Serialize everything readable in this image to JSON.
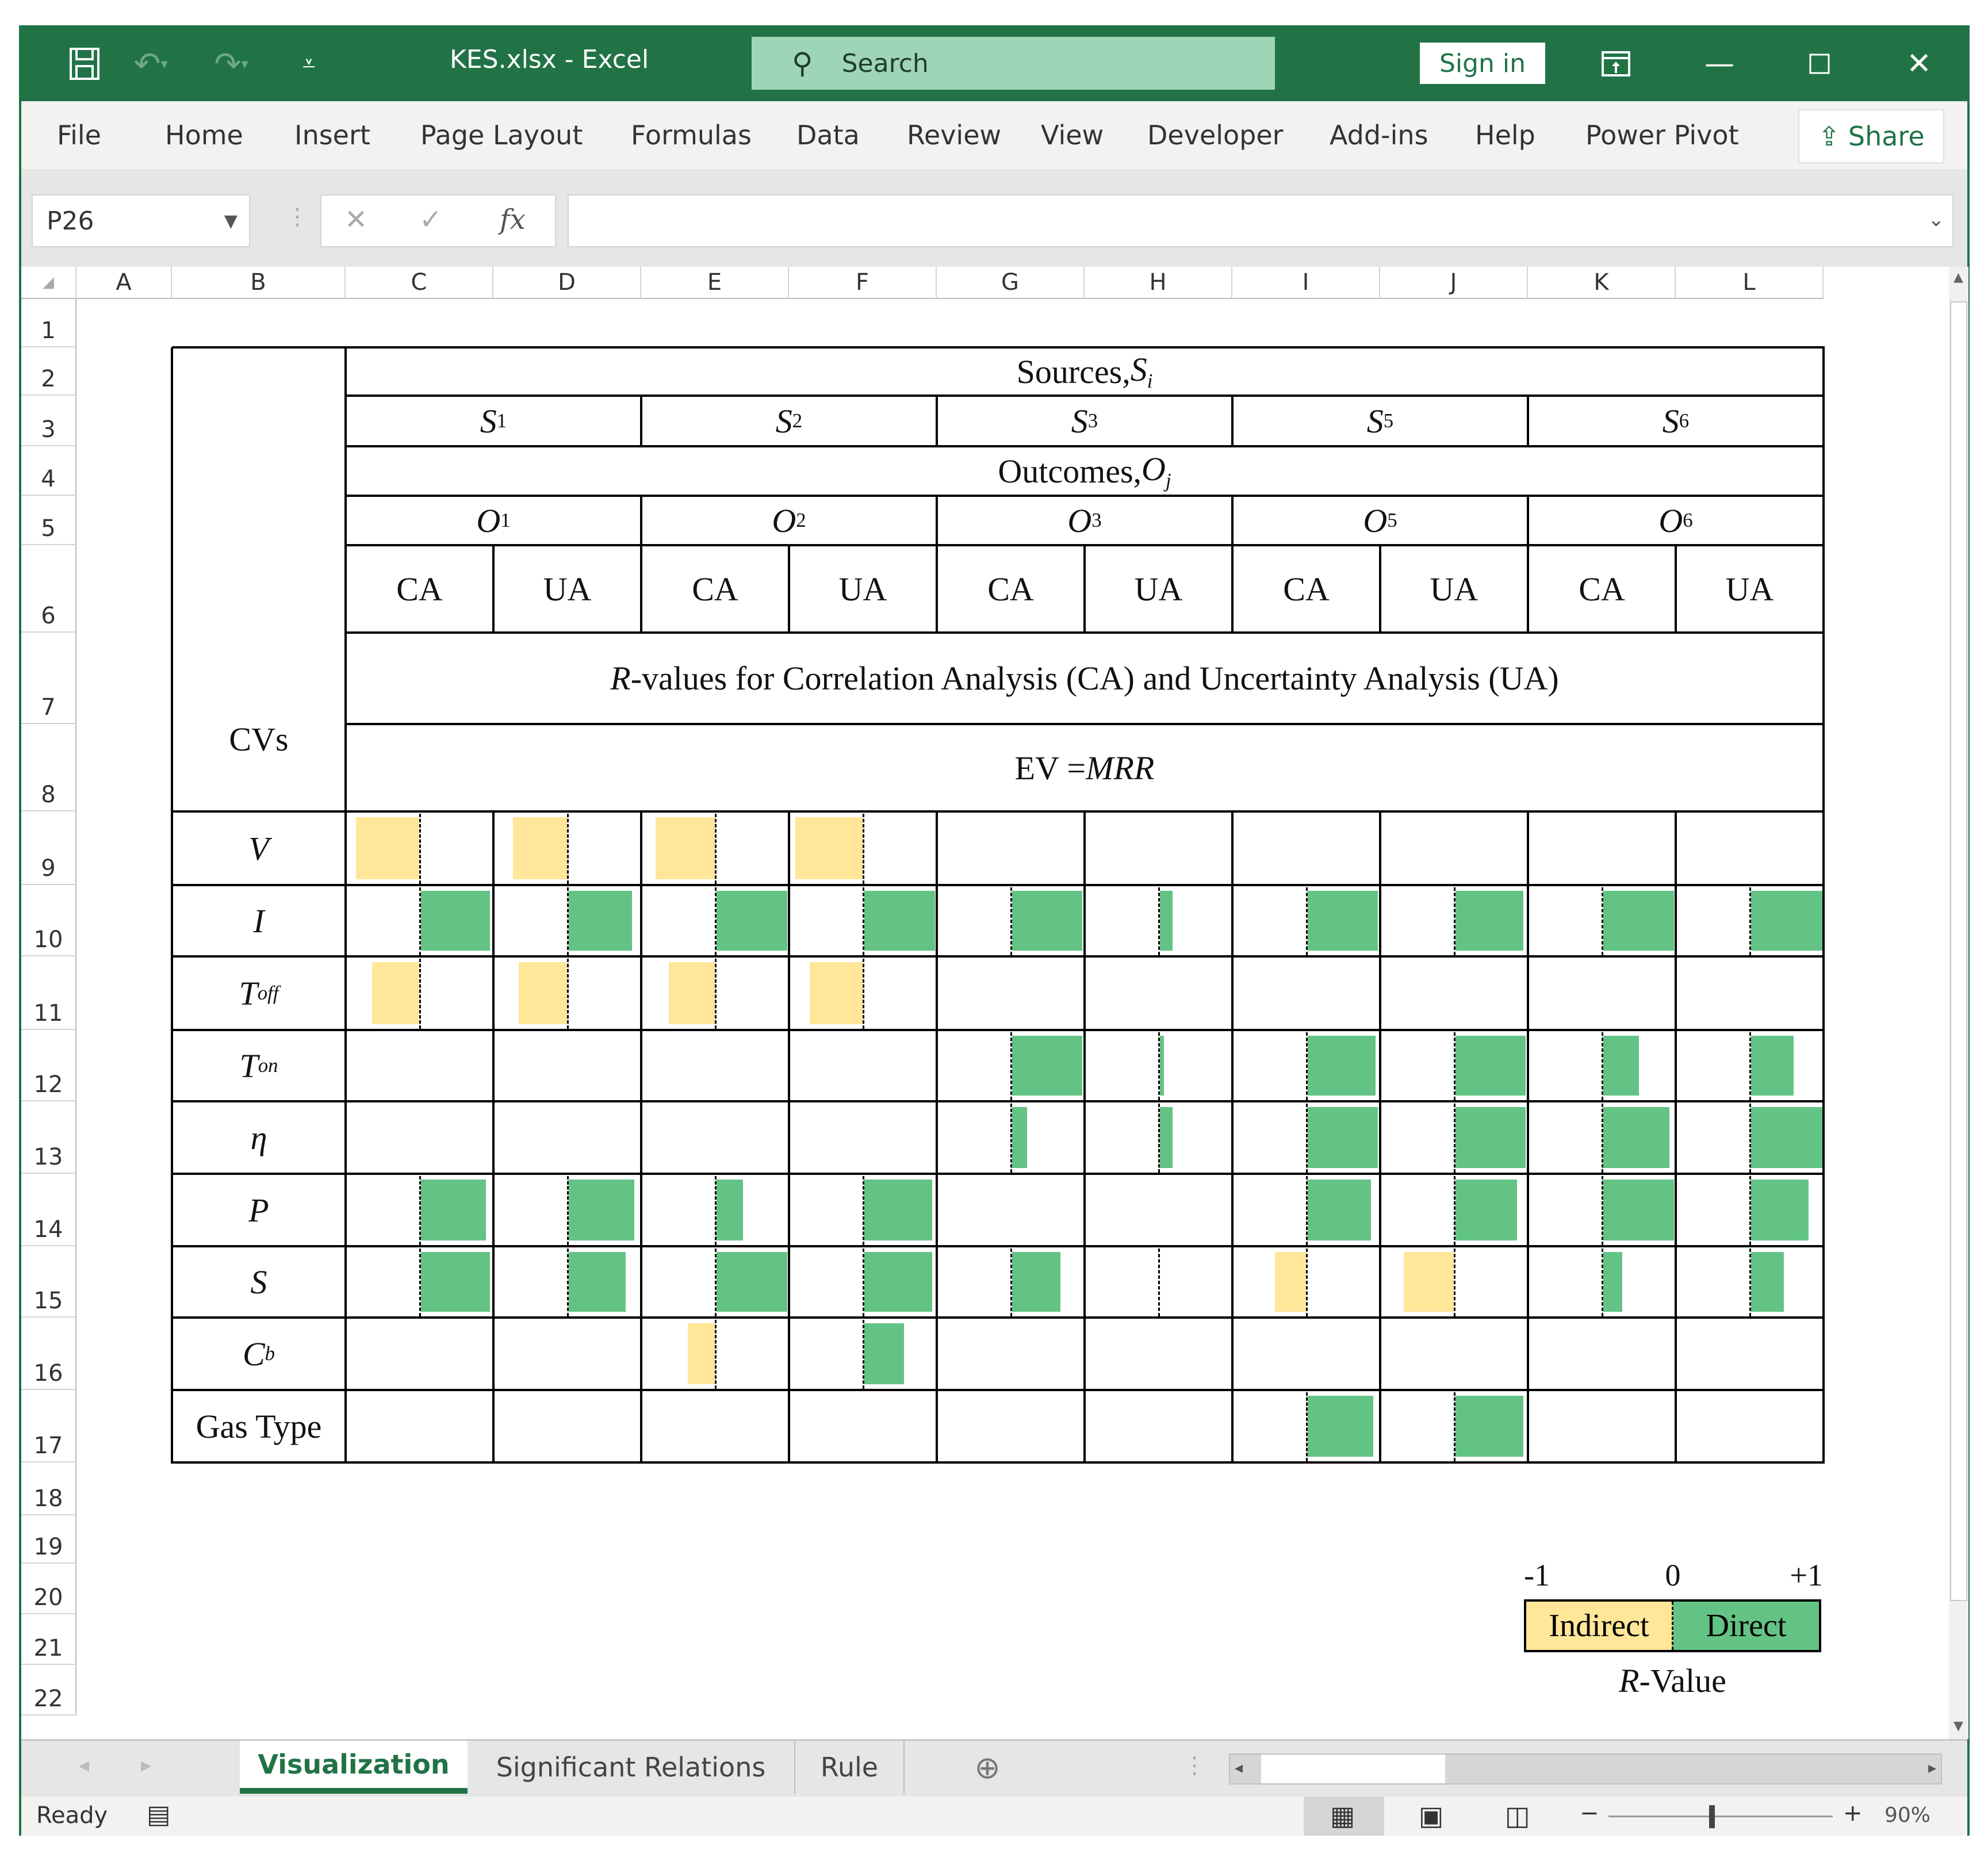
{
  "window": {
    "title": "KES.xlsx  -  Excel",
    "search_placeholder": "Search",
    "sign_in": "Sign in",
    "icons": [
      "save-icon",
      "undo-icon",
      "redo-icon",
      "customize-qat-icon",
      "ribbon-display-icon",
      "minimize-icon",
      "maximize-icon",
      "close-icon"
    ]
  },
  "ribbon": {
    "tabs": [
      "File",
      "Home",
      "Insert",
      "Page Layout",
      "Formulas",
      "Data",
      "Review",
      "View",
      "Developer",
      "Add-ins",
      "Help",
      "Power Pivot"
    ],
    "share": "Share"
  },
  "formula_bar": {
    "name_box": "P26",
    "formula": ""
  },
  "columns": [
    "A",
    "B",
    "C",
    "D",
    "E",
    "F",
    "G",
    "H",
    "I",
    "J",
    "K",
    "L"
  ],
  "rows": [
    "1",
    "2",
    "3",
    "4",
    "5",
    "6",
    "7",
    "8",
    "9",
    "10",
    "11",
    "12",
    "13",
    "14",
    "15",
    "16",
    "17",
    "18",
    "19",
    "20",
    "21",
    "22"
  ],
  "table": {
    "sources_title": "Sources, ",
    "sources_symbol": "S",
    "sources_sub": "i",
    "sources": [
      {
        "sym": "S",
        "sub": "1"
      },
      {
        "sym": "S",
        "sub": "2"
      },
      {
        "sym": "S",
        "sub": "3"
      },
      {
        "sym": "S",
        "sub": "5"
      },
      {
        "sym": "S",
        "sub": "6"
      }
    ],
    "outcomes_title": "Outcomes, ",
    "outcomes_symbol": "O",
    "outcomes_sub": "j",
    "outcomes": [
      {
        "sym": "O",
        "sub": "1"
      },
      {
        "sym": "O",
        "sub": "2"
      },
      {
        "sym": "O",
        "sub": "3"
      },
      {
        "sym": "O",
        "sub": "5"
      },
      {
        "sym": "O",
        "sub": "6"
      }
    ],
    "analysis": [
      "CA",
      "UA",
      "CA",
      "UA",
      "CA",
      "UA",
      "CA",
      "UA",
      "CA",
      "UA"
    ],
    "rvalues_R": "R",
    "rvalues_text": " -values for Correlation Analysis (CA) and Uncertainty Analysis (UA)",
    "ev_prefix": "EV = ",
    "ev_value": "MRR",
    "cv_header": "CVs",
    "cvs": [
      {
        "sym": "V",
        "sub": ""
      },
      {
        "sym": "I",
        "sub": ""
      },
      {
        "sym": "T",
        "sub": "off"
      },
      {
        "sym": "T",
        "sub": "on"
      },
      {
        "sym": "η",
        "sub": ""
      },
      {
        "sym": "P",
        "sub": ""
      },
      {
        "sym": "S",
        "sub": ""
      },
      {
        "sym": "C",
        "sub": "b"
      },
      {
        "sym": "Gas Type",
        "sub": "",
        "plain": true
      }
    ]
  },
  "chart_data": {
    "type": "heatmap",
    "title": "R-values for Correlation Analysis (CA) and Uncertainty Analysis (UA), EV = MRR",
    "x_categories": [
      "S1/O1 CA",
      "S1/O1 UA",
      "S2/O2 CA",
      "S2/O2 UA",
      "S3/O3 CA",
      "S3/O3 UA",
      "S5/O5 CA",
      "S5/O5 UA",
      "S6/O6 CA",
      "S6/O6 UA"
    ],
    "y_categories": [
      "V",
      "I",
      "T_off",
      "T_on",
      "η",
      "P",
      "S",
      "C_b",
      "Gas Type"
    ],
    "value_range": [
      -1,
      1
    ],
    "values": [
      [
        -0.89,
        -0.76,
        -0.83,
        -0.94,
        null,
        null,
        null,
        null,
        null,
        null
      ],
      [
        0.97,
        0.89,
        0.99,
        0.99,
        0.98,
        0.18,
        0.98,
        0.95,
        0.99,
        1.0
      ],
      [
        -0.66,
        -0.68,
        -0.65,
        -0.74,
        null,
        null,
        null,
        null,
        null,
        null
      ],
      [
        null,
        null,
        null,
        null,
        0.98,
        0.06,
        0.95,
        0.98,
        0.5,
        0.6
      ],
      [
        null,
        null,
        null,
        null,
        0.21,
        0.18,
        0.98,
        0.98,
        0.93,
        1.0
      ],
      [
        0.91,
        0.92,
        0.37,
        0.95,
        null,
        null,
        0.89,
        0.86,
        0.99,
        0.81
      ],
      [
        0.97,
        0.8,
        0.99,
        0.95,
        0.68,
        0.0,
        -0.44,
        -0.7,
        0.27,
        0.46
      ],
      [
        null,
        null,
        -0.38,
        0.56,
        null,
        null,
        null,
        null,
        null,
        null
      ],
      [
        null,
        null,
        null,
        null,
        null,
        null,
        0.92,
        0.95,
        null,
        null
      ]
    ],
    "colors": {
      "negative": "#ffe699",
      "positive": "#63c384"
    }
  },
  "legend": {
    "min": "-1",
    "mid": "0",
    "max": "+1",
    "negative_label": "Indirect",
    "positive_label": "Direct",
    "caption_R": "R",
    "caption_text": "-Value"
  },
  "sheets": {
    "tabs": [
      "Visualization",
      "Significant Relations",
      "Rule"
    ],
    "active": "Visualization"
  },
  "status": {
    "ready": "Ready",
    "zoom": "90%",
    "zoom_level": 0.9
  }
}
